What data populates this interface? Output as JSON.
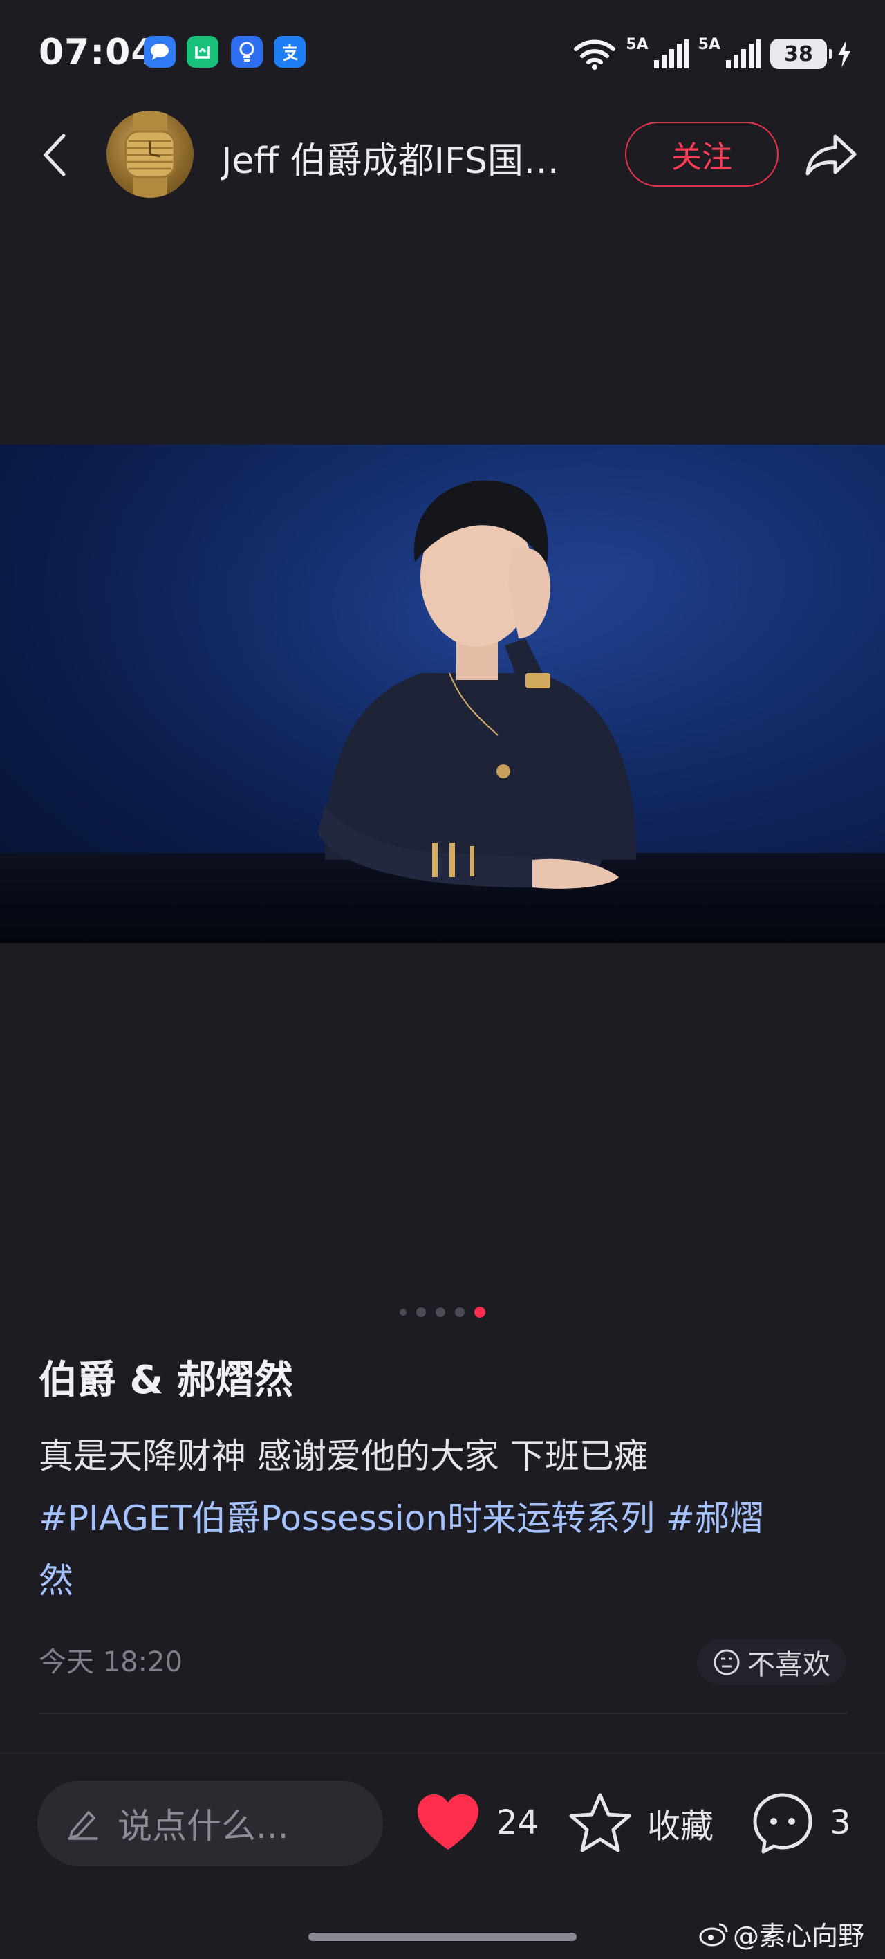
{
  "status_bar": {
    "time": "07:04",
    "app_icons": [
      {
        "name": "message-app-icon",
        "color": "#2f7bf5"
      },
      {
        "name": "mi-home-app-icon",
        "color": "#19c07a"
      },
      {
        "name": "lightbulb-app-icon",
        "color": "#2d6ff0"
      },
      {
        "name": "alipay-app-icon",
        "color": "#1f7ef5"
      }
    ],
    "sim1_label": "5A",
    "sim2_label": "5A",
    "battery_level": "38"
  },
  "header": {
    "author_name": "Jeff 伯爵成都IFS国…",
    "follow_label": "关注"
  },
  "media": {
    "page_count": 5,
    "current_page": 5
  },
  "post": {
    "title": "伯爵 & 郝熠然",
    "text": "真是天降财神 感谢爱他的大家  下班已瘫",
    "hashtag_1": "#PIAGET伯爵Possession时来运转系列",
    "hashtag_2_part1": "#郝熠",
    "hashtag_2_part2": "然",
    "date": "今天 18:20",
    "dislike_label": "不喜欢"
  },
  "bottom_bar": {
    "comment_placeholder": "说点什么...",
    "like_count": "24",
    "collect_label": "收藏",
    "comment_count": "3"
  },
  "watermark": "@素心向野",
  "colors": {
    "background": "#1c1c22",
    "accent_red": "#ff2e4d",
    "hashtag_blue": "#a6c3ff"
  }
}
